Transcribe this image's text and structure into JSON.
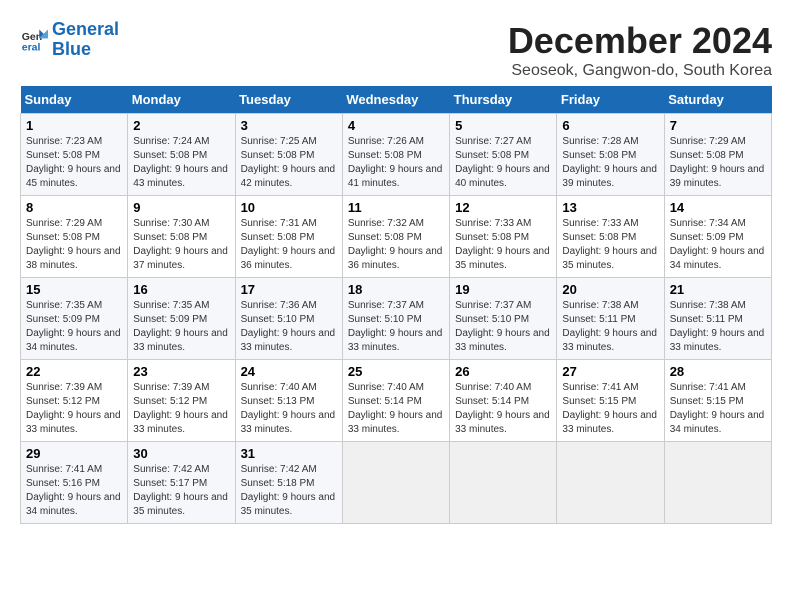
{
  "logo": {
    "line1": "General",
    "line2": "Blue"
  },
  "title": "December 2024",
  "subtitle": "Seoseok, Gangwon-do, South Korea",
  "days_of_week": [
    "Sunday",
    "Monday",
    "Tuesday",
    "Wednesday",
    "Thursday",
    "Friday",
    "Saturday"
  ],
  "weeks": [
    [
      {
        "day": "1",
        "sunrise": "7:23 AM",
        "sunset": "5:08 PM",
        "daylight": "9 hours and 45 minutes."
      },
      {
        "day": "2",
        "sunrise": "7:24 AM",
        "sunset": "5:08 PM",
        "daylight": "9 hours and 43 minutes."
      },
      {
        "day": "3",
        "sunrise": "7:25 AM",
        "sunset": "5:08 PM",
        "daylight": "9 hours and 42 minutes."
      },
      {
        "day": "4",
        "sunrise": "7:26 AM",
        "sunset": "5:08 PM",
        "daylight": "9 hours and 41 minutes."
      },
      {
        "day": "5",
        "sunrise": "7:27 AM",
        "sunset": "5:08 PM",
        "daylight": "9 hours and 40 minutes."
      },
      {
        "day": "6",
        "sunrise": "7:28 AM",
        "sunset": "5:08 PM",
        "daylight": "9 hours and 39 minutes."
      },
      {
        "day": "7",
        "sunrise": "7:29 AM",
        "sunset": "5:08 PM",
        "daylight": "9 hours and 39 minutes."
      }
    ],
    [
      {
        "day": "8",
        "sunrise": "7:29 AM",
        "sunset": "5:08 PM",
        "daylight": "9 hours and 38 minutes."
      },
      {
        "day": "9",
        "sunrise": "7:30 AM",
        "sunset": "5:08 PM",
        "daylight": "9 hours and 37 minutes."
      },
      {
        "day": "10",
        "sunrise": "7:31 AM",
        "sunset": "5:08 PM",
        "daylight": "9 hours and 36 minutes."
      },
      {
        "day": "11",
        "sunrise": "7:32 AM",
        "sunset": "5:08 PM",
        "daylight": "9 hours and 36 minutes."
      },
      {
        "day": "12",
        "sunrise": "7:33 AM",
        "sunset": "5:08 PM",
        "daylight": "9 hours and 35 minutes."
      },
      {
        "day": "13",
        "sunrise": "7:33 AM",
        "sunset": "5:08 PM",
        "daylight": "9 hours and 35 minutes."
      },
      {
        "day": "14",
        "sunrise": "7:34 AM",
        "sunset": "5:09 PM",
        "daylight": "9 hours and 34 minutes."
      }
    ],
    [
      {
        "day": "15",
        "sunrise": "7:35 AM",
        "sunset": "5:09 PM",
        "daylight": "9 hours and 34 minutes."
      },
      {
        "day": "16",
        "sunrise": "7:35 AM",
        "sunset": "5:09 PM",
        "daylight": "9 hours and 33 minutes."
      },
      {
        "day": "17",
        "sunrise": "7:36 AM",
        "sunset": "5:10 PM",
        "daylight": "9 hours and 33 minutes."
      },
      {
        "day": "18",
        "sunrise": "7:37 AM",
        "sunset": "5:10 PM",
        "daylight": "9 hours and 33 minutes."
      },
      {
        "day": "19",
        "sunrise": "7:37 AM",
        "sunset": "5:10 PM",
        "daylight": "9 hours and 33 minutes."
      },
      {
        "day": "20",
        "sunrise": "7:38 AM",
        "sunset": "5:11 PM",
        "daylight": "9 hours and 33 minutes."
      },
      {
        "day": "21",
        "sunrise": "7:38 AM",
        "sunset": "5:11 PM",
        "daylight": "9 hours and 33 minutes."
      }
    ],
    [
      {
        "day": "22",
        "sunrise": "7:39 AM",
        "sunset": "5:12 PM",
        "daylight": "9 hours and 33 minutes."
      },
      {
        "day": "23",
        "sunrise": "7:39 AM",
        "sunset": "5:12 PM",
        "daylight": "9 hours and 33 minutes."
      },
      {
        "day": "24",
        "sunrise": "7:40 AM",
        "sunset": "5:13 PM",
        "daylight": "9 hours and 33 minutes."
      },
      {
        "day": "25",
        "sunrise": "7:40 AM",
        "sunset": "5:14 PM",
        "daylight": "9 hours and 33 minutes."
      },
      {
        "day": "26",
        "sunrise": "7:40 AM",
        "sunset": "5:14 PM",
        "daylight": "9 hours and 33 minutes."
      },
      {
        "day": "27",
        "sunrise": "7:41 AM",
        "sunset": "5:15 PM",
        "daylight": "9 hours and 33 minutes."
      },
      {
        "day": "28",
        "sunrise": "7:41 AM",
        "sunset": "5:15 PM",
        "daylight": "9 hours and 34 minutes."
      }
    ],
    [
      {
        "day": "29",
        "sunrise": "7:41 AM",
        "sunset": "5:16 PM",
        "daylight": "9 hours and 34 minutes."
      },
      {
        "day": "30",
        "sunrise": "7:42 AM",
        "sunset": "5:17 PM",
        "daylight": "9 hours and 35 minutes."
      },
      {
        "day": "31",
        "sunrise": "7:42 AM",
        "sunset": "5:18 PM",
        "daylight": "9 hours and 35 minutes."
      },
      null,
      null,
      null,
      null
    ]
  ]
}
